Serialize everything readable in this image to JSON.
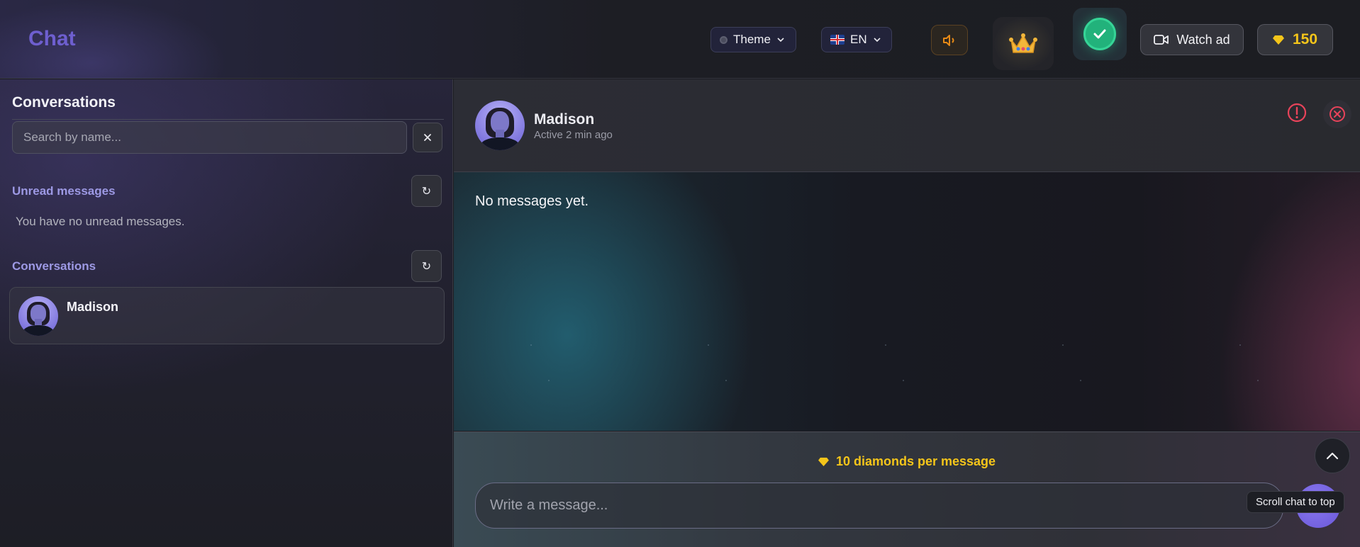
{
  "app": {
    "title": "Chat"
  },
  "topbar": {
    "theme_label": "Theme",
    "language_label": "EN",
    "watch_ad_label": "Watch ad",
    "diamonds": "150"
  },
  "sidebar": {
    "heading": "Conversations",
    "search_placeholder": "Search by name...",
    "unread_label": "Unread messages",
    "unread_empty": "You have no unread messages.",
    "conversations_label": "Conversations",
    "conversations": [
      {
        "name": "Madison"
      }
    ]
  },
  "chat": {
    "contact_name": "Madison",
    "contact_status": "Active 2 min ago",
    "empty_text": "No messages yet.",
    "cost_text": "10 diamonds per message",
    "input_placeholder": "Write a message...",
    "scroll_tooltip": "Scroll chat to top"
  },
  "colors": {
    "accent": "#6e5fcf",
    "diamond": "#f4c51a",
    "section_label": "#9d99e4",
    "danger": "#e8435a",
    "verified": "#22b27b"
  },
  "icons": [
    "chevron-down-icon",
    "flag-uk-icon",
    "speaker-icon",
    "crown-icon",
    "check-icon",
    "video-camera-icon",
    "diamond-icon",
    "close-icon",
    "refresh-icon",
    "alert-icon",
    "close-circle-icon",
    "chevron-up-icon"
  ]
}
